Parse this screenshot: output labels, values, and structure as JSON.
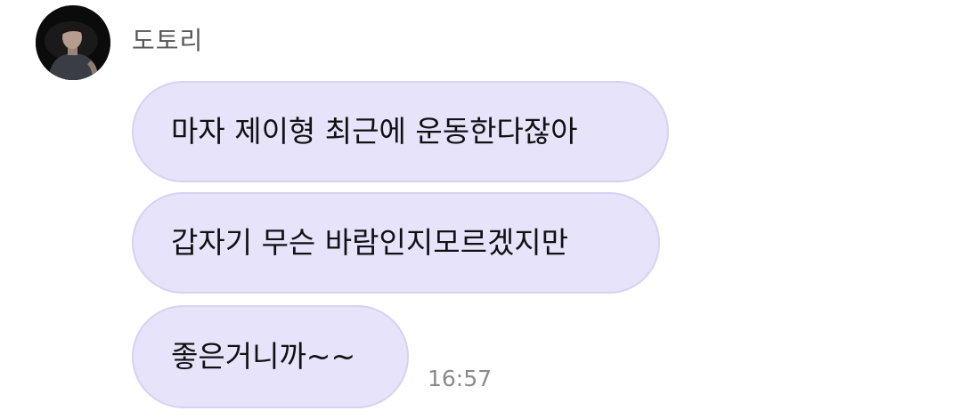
{
  "sender": {
    "name": "도토리"
  },
  "messages": [
    {
      "text": "마자 제이형 최근에 운동한다잖아"
    },
    {
      "text": "갑자기 무슨 바람인지모르겠지만"
    },
    {
      "text": "좋은거니까~~"
    }
  ],
  "timestamp": "16:57",
  "colors": {
    "bubble": "#e6e3fb",
    "bubble_border": "#d6d2f2",
    "name_text": "#555555",
    "time_text": "#8a8a8a"
  }
}
